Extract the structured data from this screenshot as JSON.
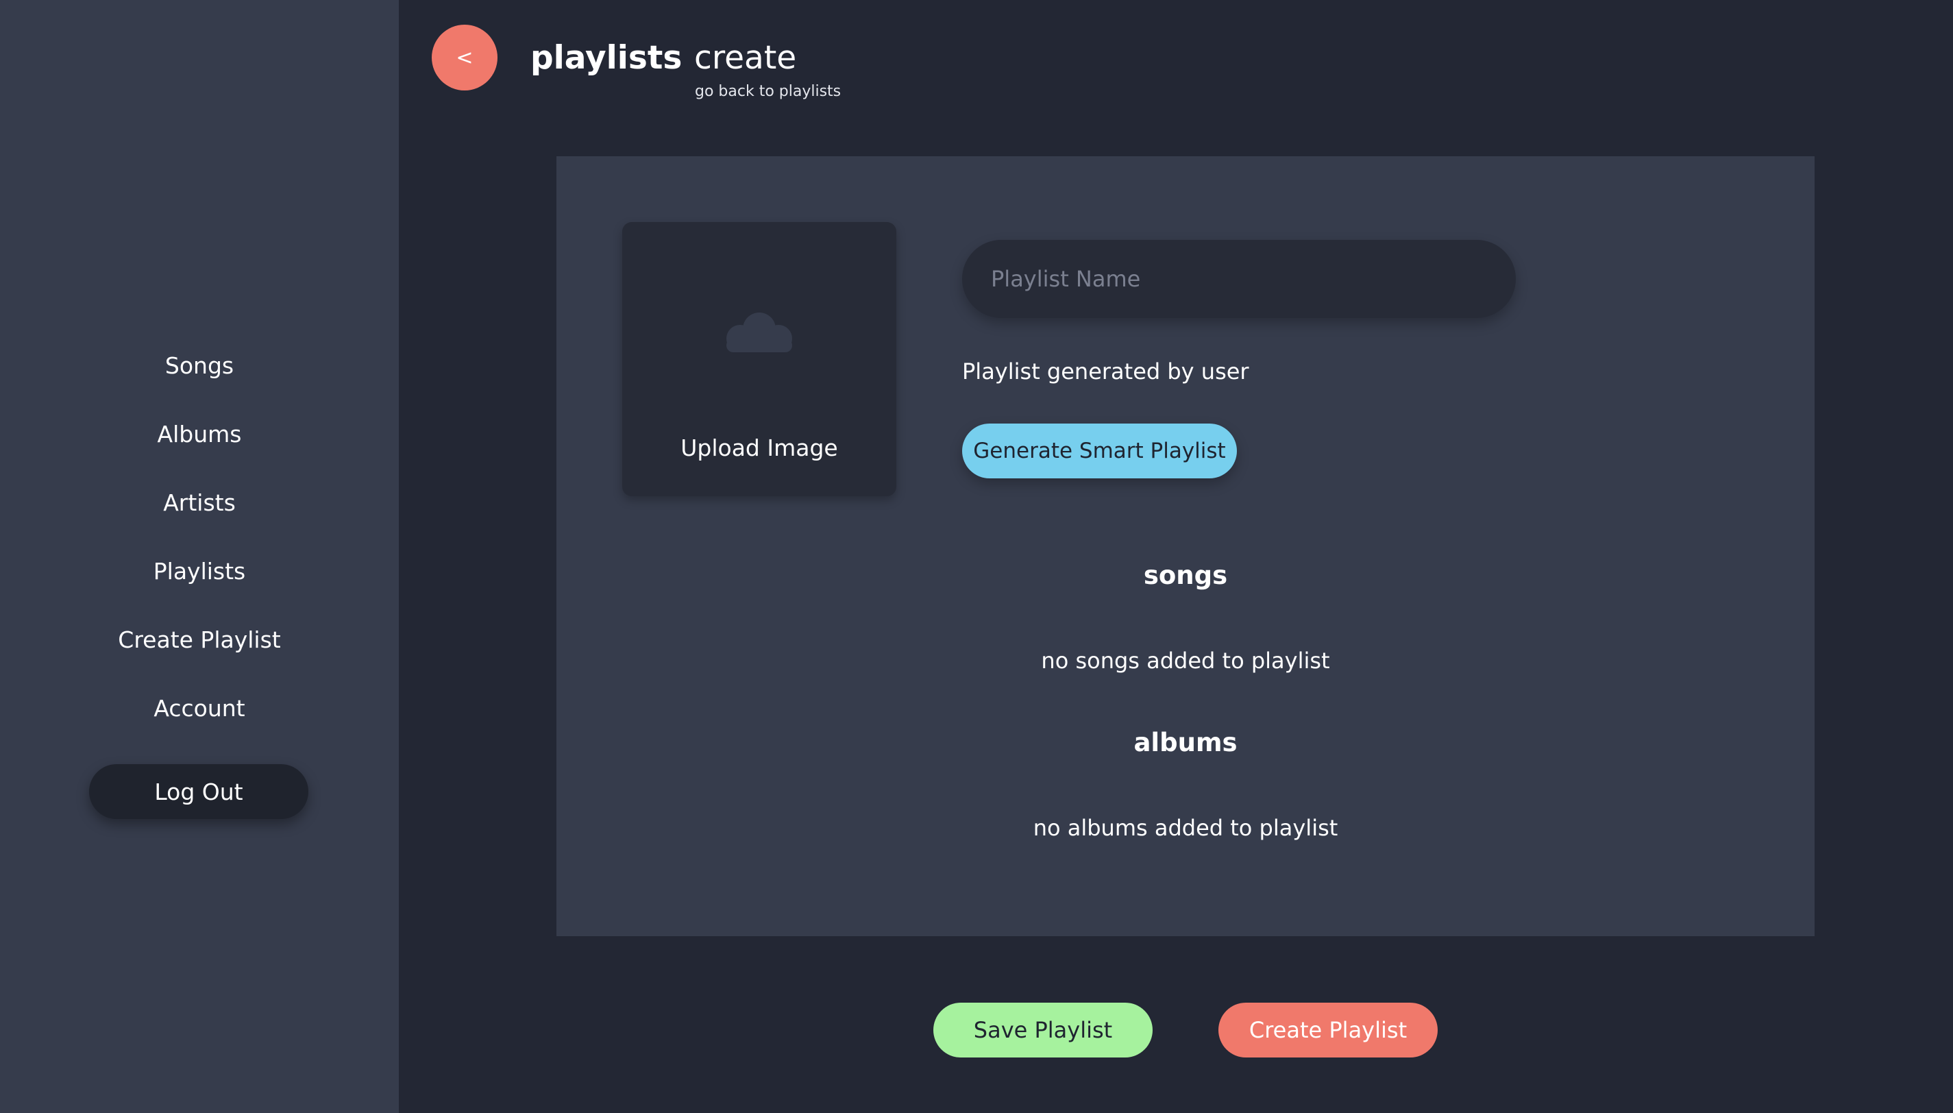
{
  "colors": {
    "sidebar_bg": "#363c4c",
    "page_bg": "#232734",
    "card_bg": "#363c4c",
    "accent_coral": "#f0796b",
    "accent_blue": "#77cfee",
    "accent_green": "#a6f29e"
  },
  "sidebar": {
    "items": [
      {
        "label": "Songs"
      },
      {
        "label": "Albums"
      },
      {
        "label": "Artists"
      },
      {
        "label": "Playlists"
      },
      {
        "label": "Create Playlist"
      },
      {
        "label": "Account"
      }
    ],
    "logout_label": "Log Out"
  },
  "header": {
    "back_icon": "<",
    "title": "playlists",
    "subtitle": "create",
    "back_link": "go back to playlists"
  },
  "card": {
    "upload": {
      "icon": "cloud-icon",
      "label": "Upload Image"
    },
    "name_input": {
      "placeholder": "Playlist Name",
      "value": ""
    },
    "generated_by": "Playlist generated by user",
    "smart_button": "Generate Smart Playlist",
    "songs": {
      "heading": "songs",
      "empty": "no songs added to playlist"
    },
    "albums": {
      "heading": "albums",
      "empty": "no albums added to playlist"
    }
  },
  "actions": {
    "save_label": "Save Playlist",
    "create_label": "Create Playlist"
  }
}
